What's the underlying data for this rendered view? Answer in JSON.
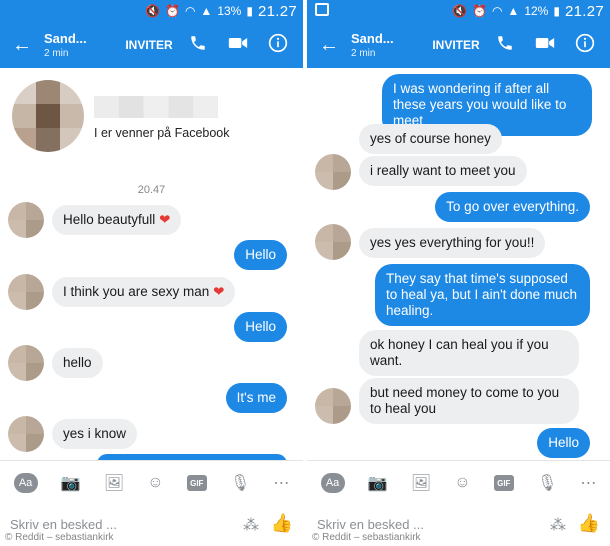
{
  "left": {
    "status": {
      "battery": "13%",
      "time": "21.27"
    },
    "header": {
      "name": "Sand...",
      "sub": "2 min",
      "invite": "INVITER"
    },
    "profile": {
      "friends_text": "I er venner på Facebook"
    },
    "timestamp": "20.47",
    "messages": [
      {
        "dir": "in",
        "text": "Hello beautyfull",
        "emoji": "❤"
      },
      {
        "dir": "out",
        "text": "Hello"
      },
      {
        "dir": "in",
        "text": "I think you are sexy man",
        "emoji": "❤"
      },
      {
        "dir": "out",
        "text": "Hello"
      },
      {
        "dir": "in",
        "text": "hello"
      },
      {
        "dir": "out",
        "text": "It's me"
      },
      {
        "dir": "in",
        "text": "yes i know"
      }
    ],
    "composer": {
      "placeholder": "Skriv en besked ..."
    },
    "watermark": "© Reddit – sebastiankirk"
  },
  "right": {
    "status": {
      "battery": "12%",
      "time": "21.27"
    },
    "header": {
      "name": "Sand...",
      "sub": "2 min",
      "invite": "INVITER"
    },
    "messages": [
      {
        "dir": "out",
        "text": "I was wondering if after all these years you would like to meet"
      },
      {
        "dir": "in",
        "text": "yes of course honey"
      },
      {
        "dir": "in",
        "text": "i really want to meet you"
      },
      {
        "dir": "out",
        "text": "To go over everything."
      },
      {
        "dir": "in",
        "text": "yes yes everything for you!!"
      },
      {
        "dir": "out",
        "text": "They say that time's supposed to heal ya, but I ain't done much healing."
      },
      {
        "dir": "in",
        "text": "ok honey I can heal you if you want."
      },
      {
        "dir": "in",
        "text": "but need money to come to you to heal you"
      },
      {
        "dir": "out",
        "text": "Hello"
      }
    ],
    "composer": {
      "placeholder": "Skriv en besked ..."
    },
    "watermark": "© Reddit – sebastiankirk"
  },
  "tools": {
    "aa": "Aa",
    "gif": "GIF"
  },
  "icons": [
    "back-arrow-icon",
    "phone-icon",
    "video-camera-icon",
    "info-icon",
    "camera-icon",
    "image-icon",
    "emoji-icon",
    "gif-icon",
    "microphone-icon",
    "more-icon",
    "like-thumb-icon",
    "apps-grid-icon"
  ]
}
